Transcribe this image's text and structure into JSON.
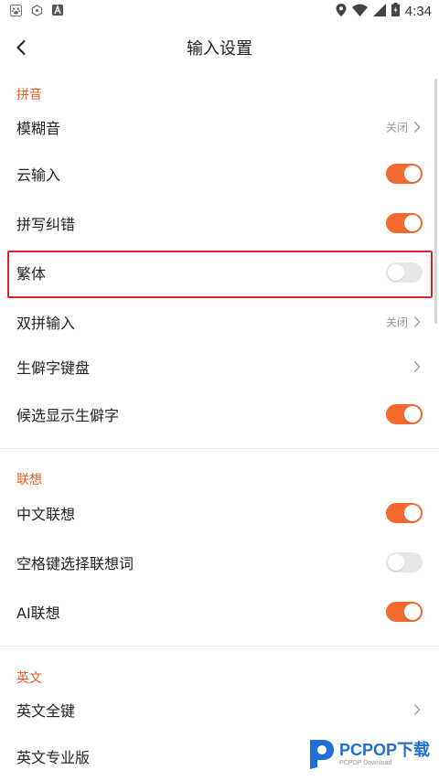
{
  "status_bar": {
    "time": "4:34"
  },
  "header": {
    "title": "输入设置"
  },
  "sections": [
    {
      "title": "拼音",
      "rows": [
        {
          "label": "模糊音",
          "type": "link",
          "value": "关闭"
        },
        {
          "label": "云输入",
          "type": "toggle",
          "on": true
        },
        {
          "label": "拼写纠错",
          "type": "toggle",
          "on": true
        },
        {
          "label": "繁体",
          "type": "toggle",
          "on": false,
          "highlighted": true
        },
        {
          "label": "双拼输入",
          "type": "link",
          "value": "关闭"
        },
        {
          "label": "生僻字键盘",
          "type": "link",
          "value": ""
        },
        {
          "label": "候选显示生僻字",
          "type": "toggle",
          "on": true
        }
      ]
    },
    {
      "title": "联想",
      "rows": [
        {
          "label": "中文联想",
          "type": "toggle",
          "on": true
        },
        {
          "label": "空格键选择联想词",
          "type": "toggle",
          "on": false
        },
        {
          "label": "AI联想",
          "type": "toggle",
          "on": true
        }
      ]
    },
    {
      "title": "英文",
      "rows": [
        {
          "label": "英文全键",
          "type": "link",
          "value": ""
        },
        {
          "label": "英文专业版",
          "type": "link",
          "value": ""
        }
      ]
    }
  ],
  "watermark": {
    "main": "PCPOP下载",
    "sub": "PCPOP Download"
  },
  "colors": {
    "accent": "#f26a2e",
    "section_title": "#ef5a24",
    "highlight_border": "#e0242a",
    "toggle_off": "#e6e6e6"
  }
}
